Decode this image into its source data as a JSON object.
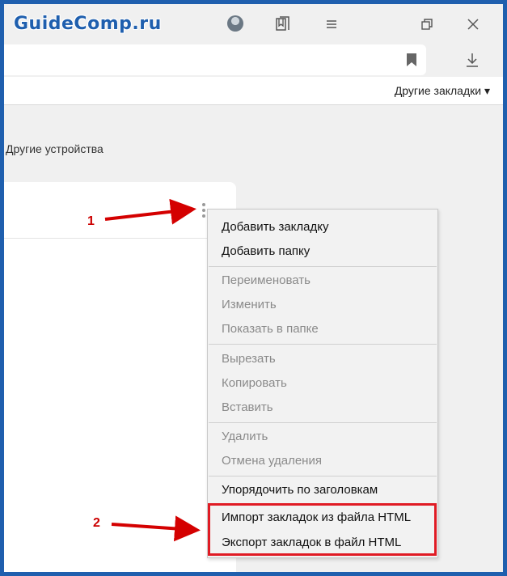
{
  "watermark": {
    "text": "GuideComp.ru"
  },
  "bookmarks_bar": {
    "other_bookmarks": "Другие закладки ▾"
  },
  "content": {
    "other_devices": "Другие устройства"
  },
  "context_menu": {
    "items": [
      {
        "label": "Добавить закладку",
        "enabled": true
      },
      {
        "label": "Добавить папку",
        "enabled": true
      },
      {
        "label": "Переименовать",
        "enabled": false
      },
      {
        "label": "Изменить",
        "enabled": false
      },
      {
        "label": "Показать в папке",
        "enabled": false
      },
      {
        "label": "Вырезать",
        "enabled": false
      },
      {
        "label": "Копировать",
        "enabled": false
      },
      {
        "label": "Вставить",
        "enabled": false
      },
      {
        "label": "Удалить",
        "enabled": false
      },
      {
        "label": "Отмена удаления",
        "enabled": false
      },
      {
        "label": "Упорядочить по заголовкам",
        "enabled": true
      },
      {
        "label": "Импорт закладок из файла HTML",
        "enabled": true
      },
      {
        "label": "Экспорт закладок в файл HTML",
        "enabled": true
      }
    ]
  },
  "annotations": {
    "step1": "1",
    "step2": "2"
  },
  "colors": {
    "frame": "#1f5fae",
    "highlight": "#e01b24",
    "arrow": "#d40000"
  },
  "icons": [
    "bookmark-flag-icon",
    "bookmarks-manager-icon",
    "menu-icon",
    "restore-window-icon",
    "close-icon",
    "download-icon",
    "kebab-menu-icon"
  ]
}
